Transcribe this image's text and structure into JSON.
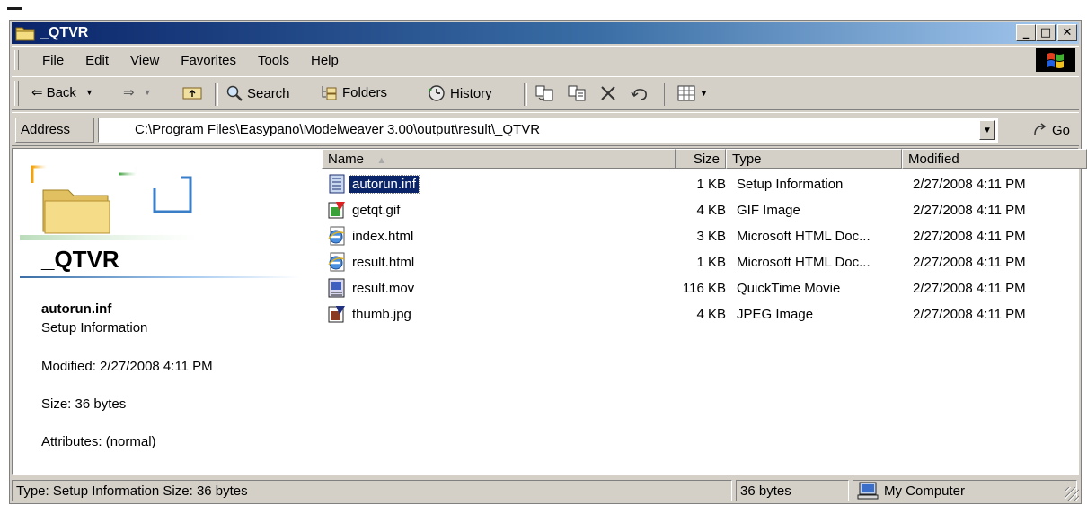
{
  "window": {
    "title": "_QTVR",
    "controls": {
      "minimize": "_",
      "maximize": "□",
      "close": "✕"
    }
  },
  "menubar": {
    "items": [
      "File",
      "Edit",
      "View",
      "Favorites",
      "Tools",
      "Help"
    ]
  },
  "toolbar": {
    "back": "Back",
    "search": "Search",
    "folders": "Folders",
    "history": "History"
  },
  "address": {
    "label": "Address",
    "value": "C:\\Program Files\\Easypano\\Modelweaver 3.00\\output\\result\\_QTVR",
    "go": "Go"
  },
  "info_panel": {
    "folder_name": "_QTVR",
    "selected_name": "autorun.inf",
    "selected_type": "Setup Information",
    "modified": "Modified: 2/27/2008 4:11 PM",
    "size": "Size: 36 bytes",
    "attributes": "Attributes: (normal)"
  },
  "columns": {
    "name": "Name",
    "size": "Size",
    "type": "Type",
    "modified": "Modified"
  },
  "files": [
    {
      "name": "autorun.inf",
      "size": "1 KB",
      "type": "Setup Information",
      "modified": "2/27/2008 4:11 PM",
      "icon": "setup-file-icon",
      "selected": true
    },
    {
      "name": "getqt.gif",
      "size": "4 KB",
      "type": "GIF Image",
      "modified": "2/27/2008 4:11 PM",
      "icon": "image-file-icon",
      "selected": false
    },
    {
      "name": "index.html",
      "size": "3 KB",
      "type": "Microsoft HTML Doc...",
      "modified": "2/27/2008 4:11 PM",
      "icon": "html-file-icon",
      "selected": false
    },
    {
      "name": "result.html",
      "size": "1 KB",
      "type": "Microsoft HTML Doc...",
      "modified": "2/27/2008 4:11 PM",
      "icon": "html-file-icon",
      "selected": false
    },
    {
      "name": "result.mov",
      "size": "116 KB",
      "type": "QuickTime Movie",
      "modified": "2/27/2008 4:11 PM",
      "icon": "movie-file-icon",
      "selected": false
    },
    {
      "name": "thumb.jpg",
      "size": "4 KB",
      "type": "JPEG Image",
      "modified": "2/27/2008 4:11 PM",
      "icon": "image-file-icon",
      "selected": false
    }
  ],
  "statusbar": {
    "text": "Type: Setup Information Size: 36 bytes",
    "bytes": "36 bytes",
    "zone": "My Computer"
  },
  "colors": {
    "titlebar_start": "#0a246a",
    "titlebar_end": "#a6caf0",
    "chrome": "#d4d0c8",
    "selection": "#0a246a"
  }
}
